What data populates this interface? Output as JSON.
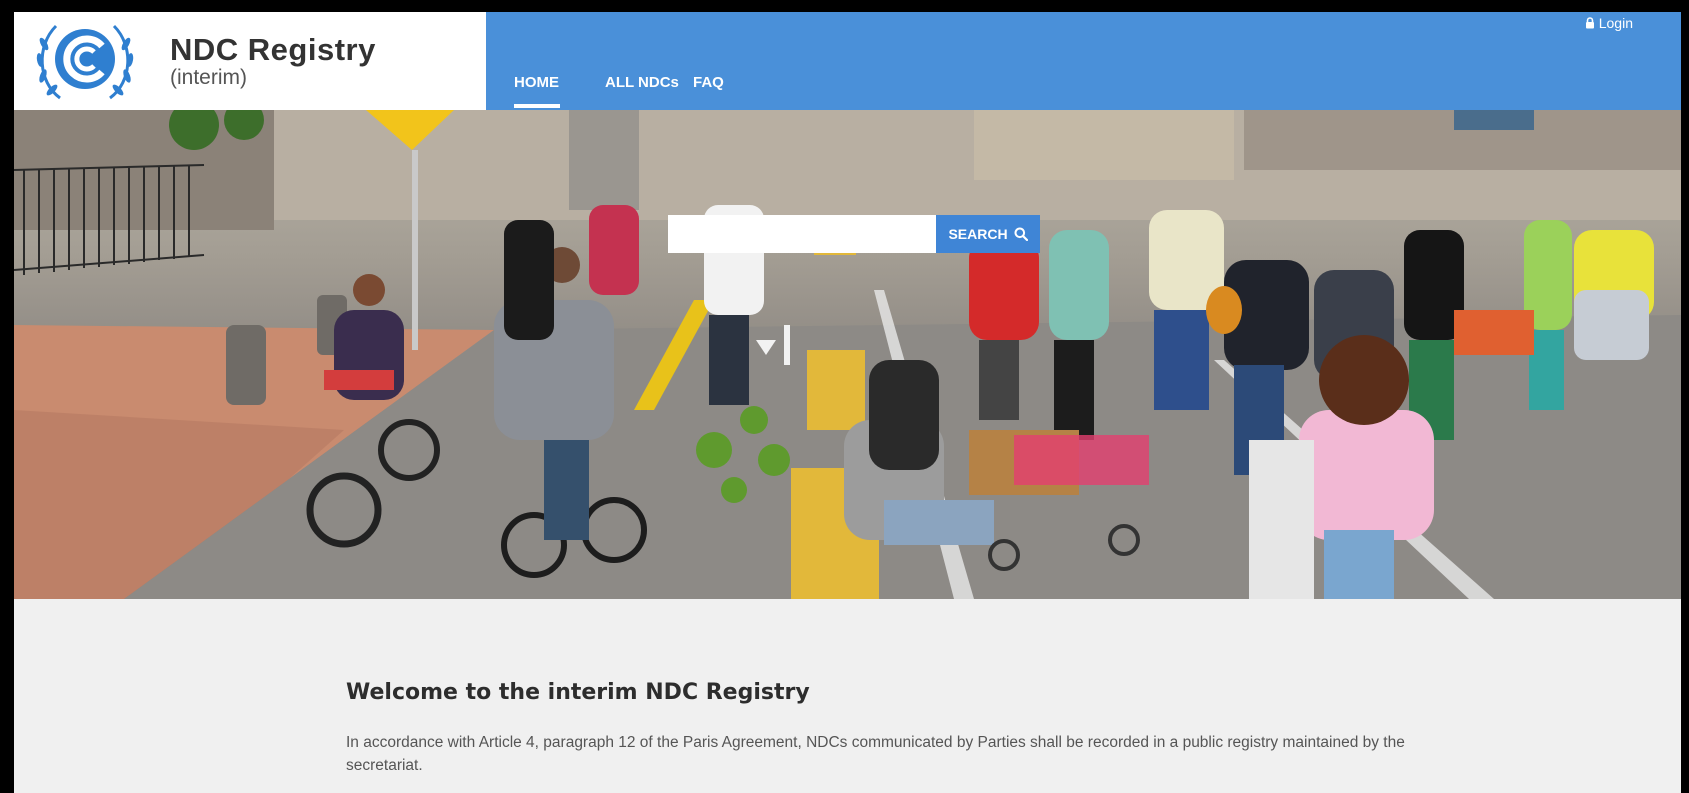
{
  "brand": {
    "title": "NDC Registry",
    "subtitle": "(interim)"
  },
  "nav": {
    "items": [
      {
        "label": "HOME",
        "active": true
      },
      {
        "label": "ALL NDCs",
        "active": false
      },
      {
        "label": "FAQ",
        "active": false
      }
    ],
    "login_label": "Login"
  },
  "search": {
    "placeholder": "",
    "value": "",
    "button_label": "SEARCH"
  },
  "content": {
    "title": "Welcome to the interim NDC Registry",
    "paragraph": "In accordance with Article 4, paragraph 12 of the Paris Agreement, NDCs communicated by Parties shall be recorded in a public registry maintained by the secretariat."
  },
  "colors": {
    "nav_bar": "#4a90d9",
    "search_button": "#3f85d6",
    "logo_blue": "#2f7fd0"
  },
  "icons": {
    "logo": "unfccc-emblem-icon",
    "login": "lock-icon",
    "search": "magnifier-icon"
  }
}
